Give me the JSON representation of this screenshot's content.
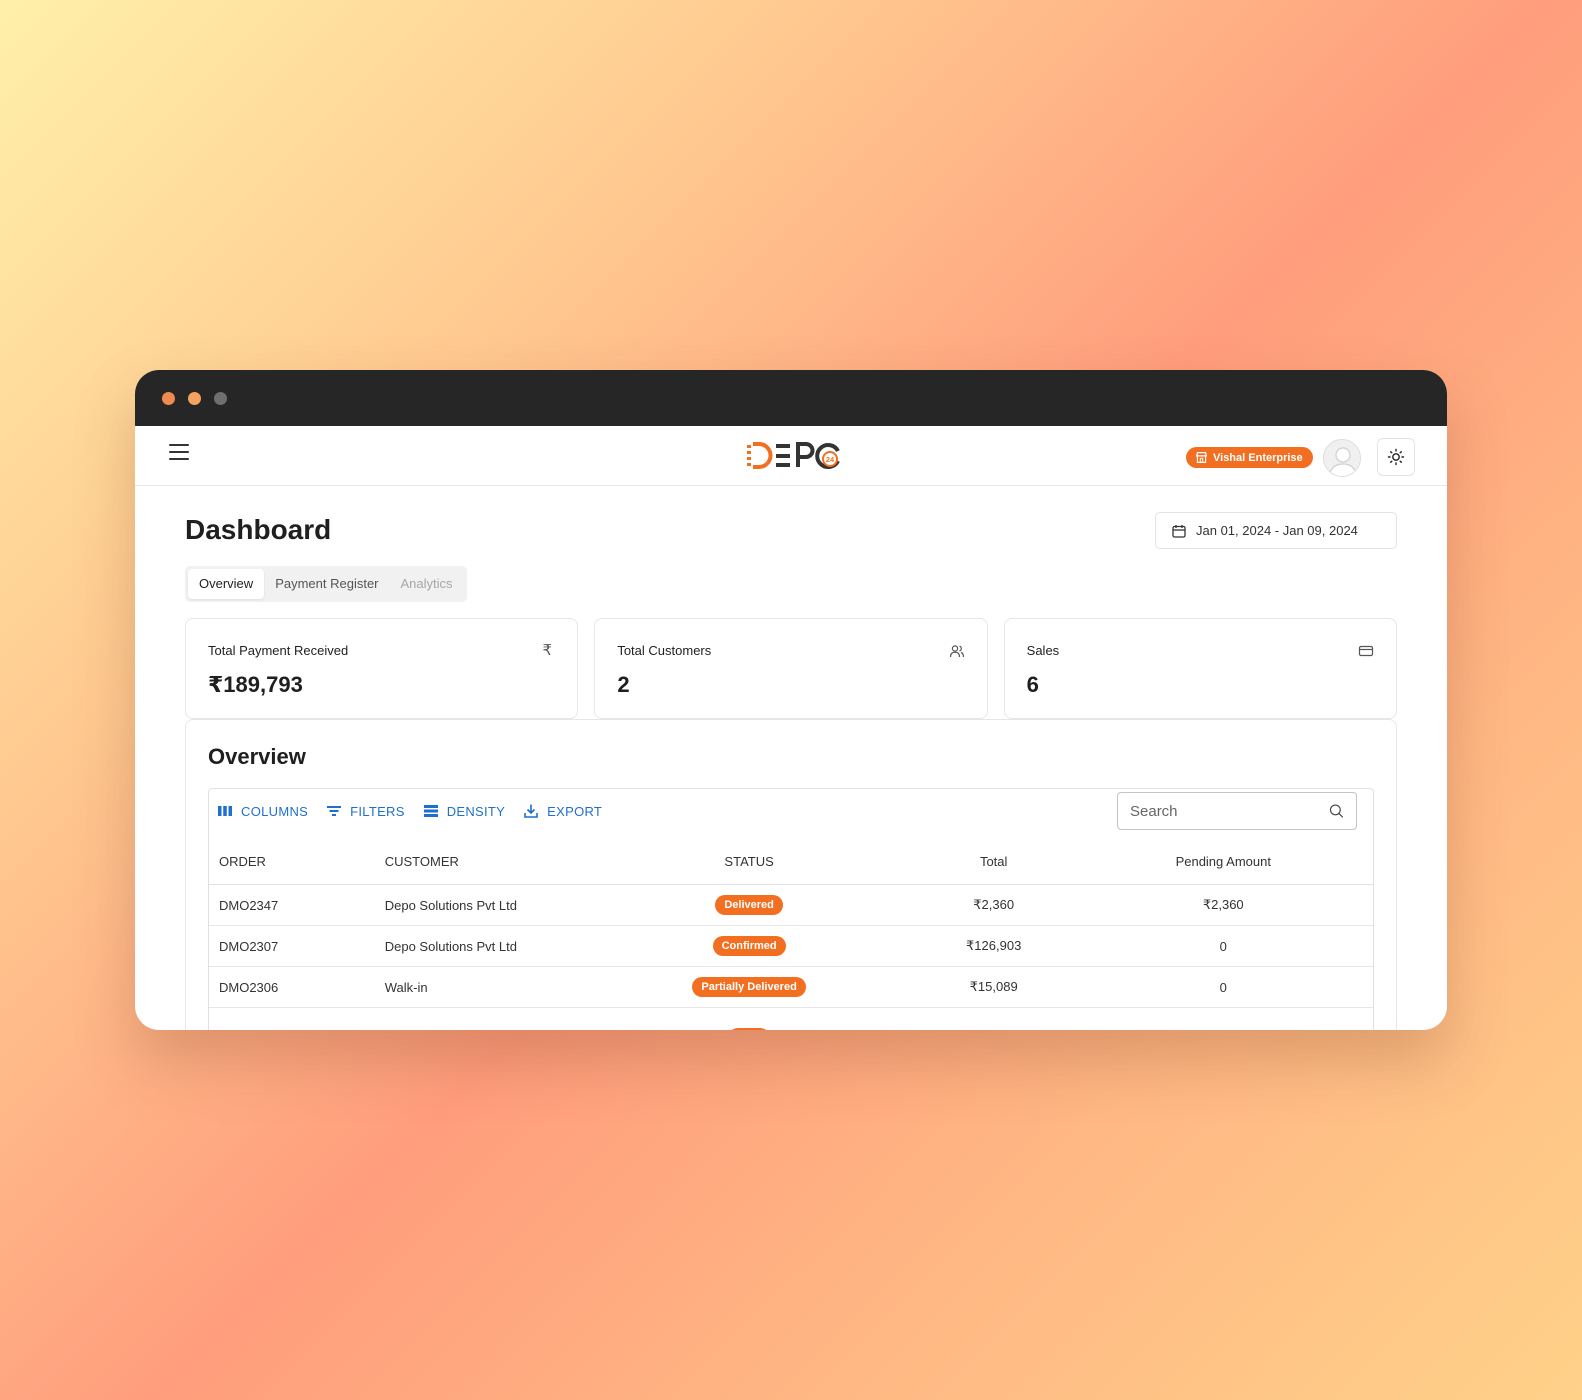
{
  "app": {
    "logo_text": "DEPO",
    "logo_sub": "24",
    "company": "Vishal Enterprise"
  },
  "page": {
    "title": "Dashboard",
    "date_range": "Jan 01, 2024 - Jan 09, 2024"
  },
  "tabs": [
    {
      "label": "Overview"
    },
    {
      "label": "Payment Register"
    },
    {
      "label": "Analytics"
    }
  ],
  "cards": [
    {
      "label": "Total Payment Received",
      "value": "₹189,793",
      "icon": "rupee-icon"
    },
    {
      "label": "Total Customers",
      "value": "2",
      "icon": "users-icon"
    },
    {
      "label": "Sales",
      "value": "6",
      "icon": "credit-card-icon"
    }
  ],
  "overview": {
    "title": "Overview",
    "toolbar": {
      "columns": "COLUMNS",
      "filters": "FILTERS",
      "density": "DENSITY",
      "export": "EXPORT"
    },
    "search_placeholder": "Search",
    "headers": {
      "order": "ORDER",
      "customer": "CUSTOMER",
      "status": "STATUS",
      "total": "Total",
      "pending": "Pending Amount"
    },
    "rows": [
      {
        "order": "DMO2347",
        "customer": "Depo Solutions Pvt Ltd",
        "status": "Delivered",
        "total": "₹2,360",
        "pending": "₹2,360"
      },
      {
        "order": "DMO2307",
        "customer": "Depo Solutions Pvt Ltd",
        "status": "Confirmed",
        "total": "₹126,903",
        "pending": "0"
      },
      {
        "order": "DMO2306",
        "customer": "Walk-in",
        "status": "Partially Delivered",
        "total": "₹15,089",
        "pending": "0"
      }
    ]
  },
  "colors": {
    "accent": "#f26f21",
    "link": "#1f6fd1",
    "titlebar": "#262626"
  }
}
